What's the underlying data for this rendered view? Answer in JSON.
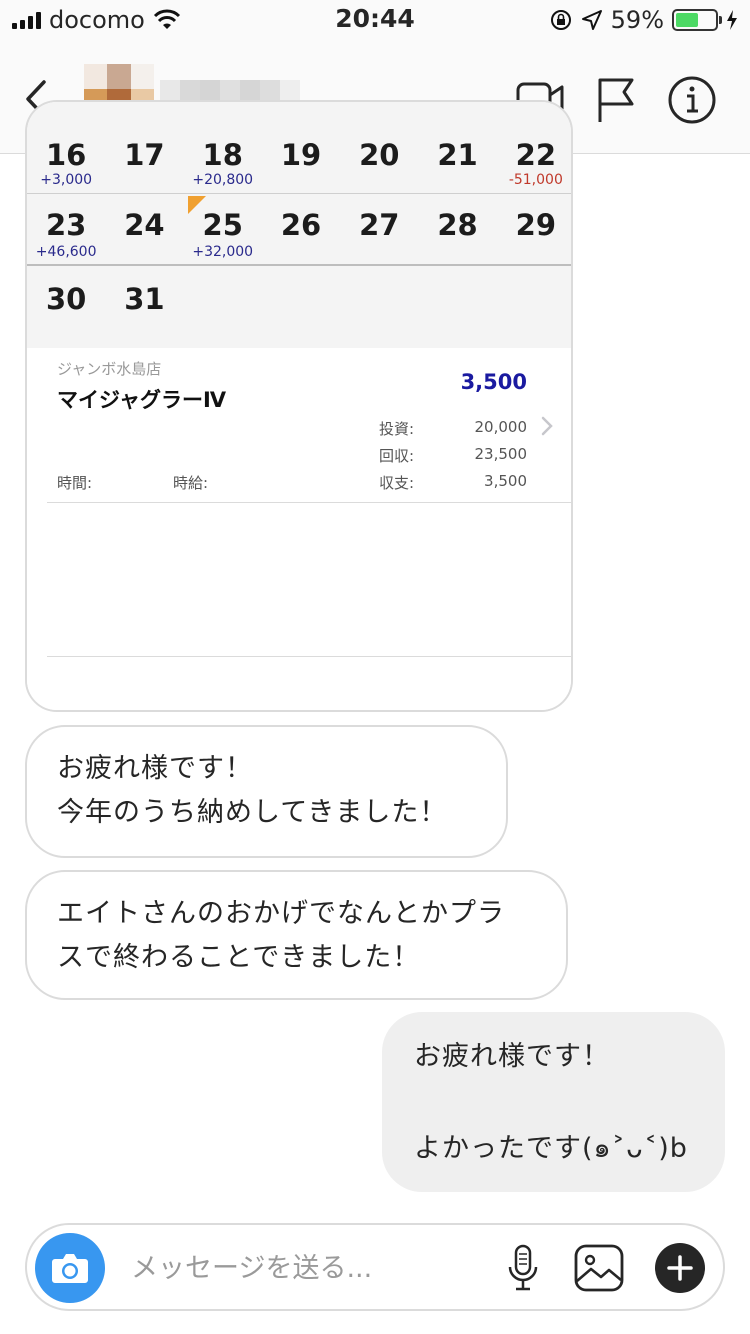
{
  "status_bar": {
    "carrier": "docomo",
    "time": "20:44",
    "battery": "59%",
    "battery_level": 0.59
  },
  "header": {
    "icons": [
      "back-chevron-icon",
      "video-call-icon",
      "flag-icon",
      "info-icon"
    ]
  },
  "shared_post": {
    "calendar": {
      "week1": [
        {
          "day": "16",
          "amount": "+3,000",
          "type": "pos"
        },
        {
          "day": "17",
          "amount": "",
          "type": ""
        },
        {
          "day": "18",
          "amount": "+20,800",
          "type": "pos"
        },
        {
          "day": "19",
          "amount": "",
          "type": ""
        },
        {
          "day": "20",
          "amount": "",
          "type": ""
        },
        {
          "day": "21",
          "amount": "",
          "type": ""
        },
        {
          "day": "22",
          "amount": "-51,000",
          "type": "neg"
        }
      ],
      "week2": [
        {
          "day": "23",
          "amount": "+46,600",
          "type": "pos"
        },
        {
          "day": "24",
          "amount": "",
          "type": ""
        },
        {
          "day": "25",
          "amount": "+32,000",
          "type": "pos",
          "marked": true
        },
        {
          "day": "26",
          "amount": "",
          "type": ""
        },
        {
          "day": "27",
          "amount": "",
          "type": ""
        },
        {
          "day": "28",
          "amount": "",
          "type": ""
        },
        {
          "day": "29",
          "amount": "",
          "type": ""
        }
      ],
      "week3": [
        {
          "day": "30",
          "amount": "",
          "type": ""
        },
        {
          "day": "31",
          "amount": "",
          "type": ""
        }
      ]
    },
    "detail": {
      "store": "ジャンボ水島店",
      "machine": "マイジャグラーⅣ",
      "profit": "3,500",
      "invest_label": "投資:",
      "invest_value": "20,000",
      "collect_label": "回収:",
      "collect_value": "23,500",
      "balance_label": "収支:",
      "balance_value": "3,500",
      "time_label": "時間:",
      "hourly_label": "時給:"
    }
  },
  "messages": [
    {
      "from": "them",
      "text": "お疲れ様です！\n今年のうち納めしてきました！"
    },
    {
      "from": "them",
      "text": "エイトさんのおかげでなんとかプラ\nスで終わることできました！"
    },
    {
      "from": "me",
      "text": "お疲れ様です！\n\nよかったです(๑˃ᴗ˂)b"
    }
  ],
  "composer": {
    "placeholder": "メッセージを送る..."
  },
  "colors": {
    "accent": "#3897f0",
    "positive": "#2a2a8c",
    "negative": "#c0392b",
    "profit": "#1a1aa0"
  }
}
